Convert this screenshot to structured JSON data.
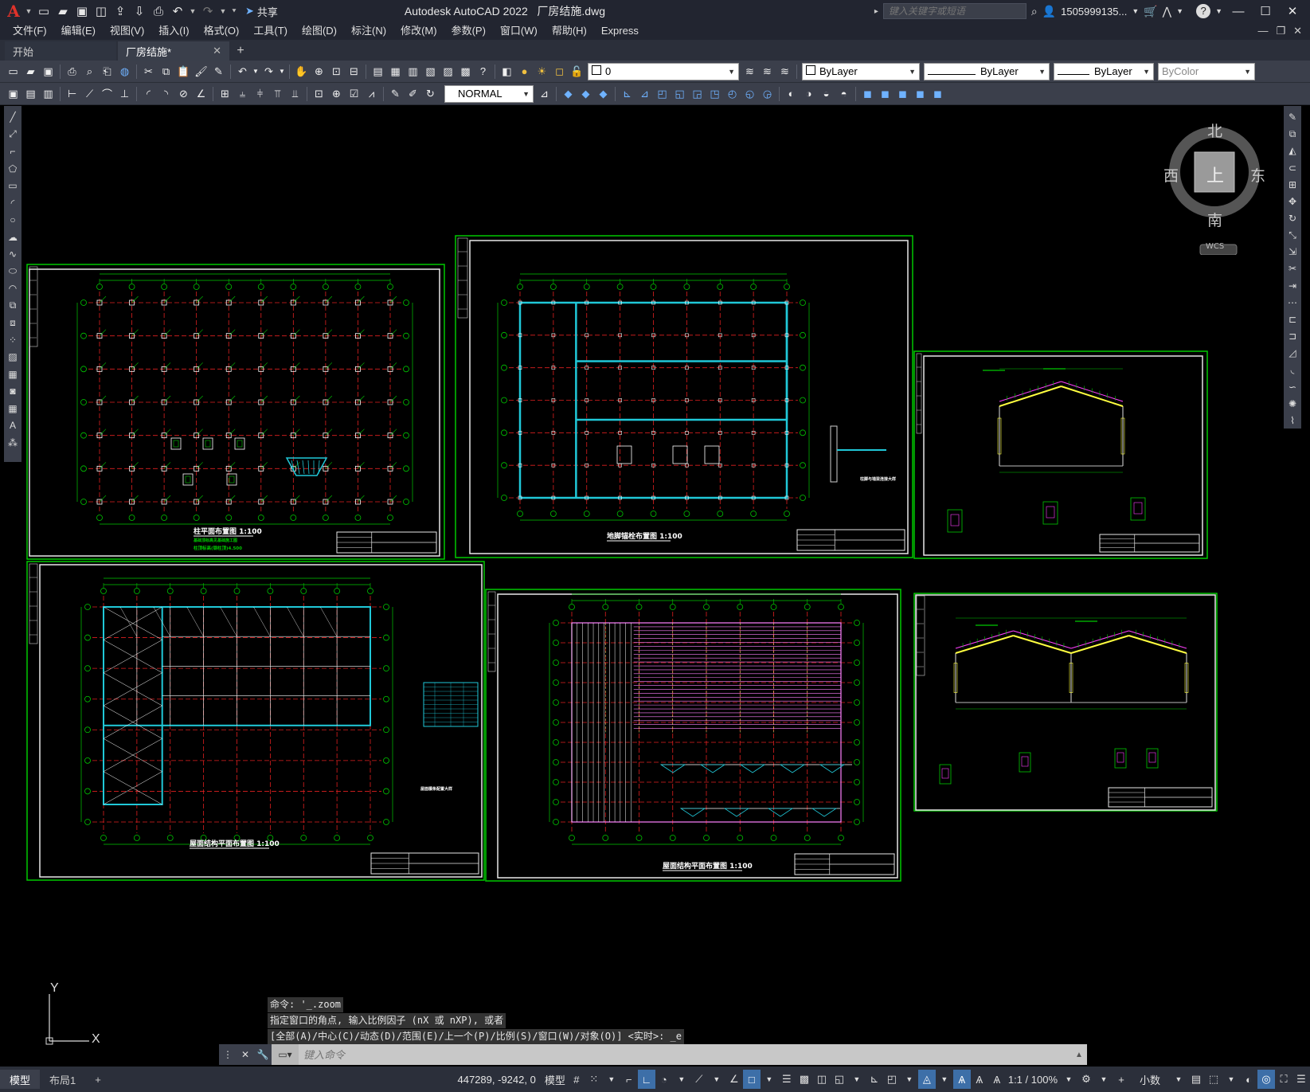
{
  "app": {
    "title": "Autodesk AutoCAD 2022",
    "file": "厂房结施.dwg",
    "logo": "A",
    "search_placeholder": "键入关键字或短语",
    "user": "1505999135...",
    "share_label": "共享"
  },
  "menu": [
    "文件(F)",
    "编辑(E)",
    "视图(V)",
    "插入(I)",
    "格式(O)",
    "工具(T)",
    "绘图(D)",
    "标注(N)",
    "修改(M)",
    "参数(P)",
    "窗口(W)",
    "帮助(H)",
    "Express"
  ],
  "tabs": [
    {
      "label": "开始"
    },
    {
      "label": "厂房结施*"
    }
  ],
  "toolbar1": {
    "layer_value": "0",
    "color_value": "ByLayer",
    "linetype_value": "ByLayer",
    "lineweight_value": "ByLayer",
    "plotstyle_value": "ByColor"
  },
  "toolbar2": {
    "dimstyle_value": "NORMAL"
  },
  "viewcube": {
    "north": "北",
    "south": "南",
    "east": "东",
    "west": "西",
    "top": "上",
    "wcs": "WCS"
  },
  "ucs": {
    "x": "X",
    "y": "Y"
  },
  "drawings": [
    {
      "title": "柱平面布置图 1:100",
      "note1": "基础顶标高见基础施工图",
      "note2": "柱顶标高(钢柱顶)4.500"
    },
    {
      "title": "地脚锚栓布置图 1:100",
      "detail": "柱脚与墙梁连接大样"
    },
    {
      "title": ""
    },
    {
      "title": "屋面结构平面布置图 1:100",
      "detail": "屋面檩条配置大样"
    },
    {
      "title": "屋面结构平面布置图 1:100"
    },
    {
      "title": ""
    }
  ],
  "command": {
    "history": [
      "命令: '_.zoom",
      "指定窗口的角点, 输入比例因子 (nX 或 nXP), 或者",
      "[全部(A)/中心(C)/动态(D)/范围(E)/上一个(P)/比例(S)/窗口(W)/对象(O)] <实时>: _e"
    ],
    "placeholder": "键入命令"
  },
  "status": {
    "layout_tabs": [
      "模型",
      "布局1"
    ],
    "coords": "447289, -9242, 0",
    "model_label": "模型",
    "scale": "1:1 / 100%",
    "units": "小数"
  },
  "colors": {
    "accent": "#3d6fa8",
    "frame": "#00c800",
    "grid_red": "#e02020",
    "cyan": "#20c8d8",
    "magenta": "#ff40ff"
  }
}
